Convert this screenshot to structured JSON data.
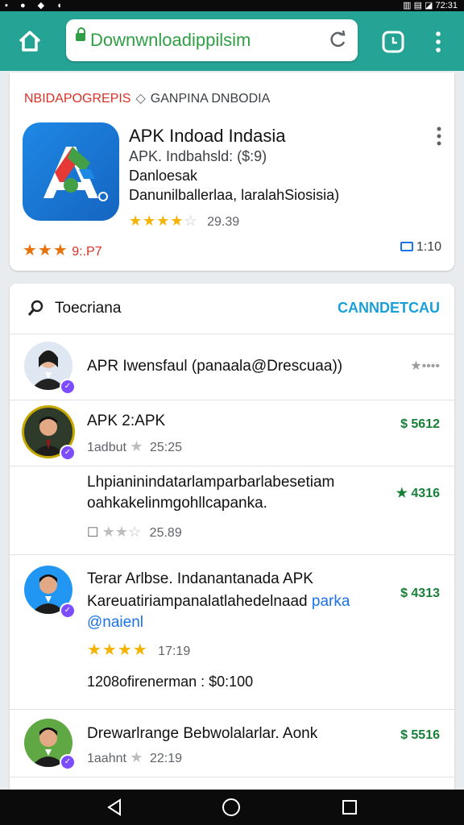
{
  "status_bar": {
    "left": "▪ ● ◆ ◖",
    "right": "▥ ▤ ◪ 72:31"
  },
  "toolbar": {
    "url": "Downwnloadippilsim"
  },
  "app": {
    "breadcrumb_primary": "NBIDAPOGREPIS",
    "breadcrumb_separator": "◇",
    "breadcrumb_secondary": "GANPINA DNBODIA",
    "title": "APK Indoad Indasia",
    "subtitle": "APK. Indbahsld: ($:9)",
    "developer": "Danloesak",
    "description": "Danunilballerlaa, laralahSiosisia)",
    "rating_stars": "★★★★",
    "rating_empty": "☆",
    "rating_count": "29.39",
    "secondary_stars": "★★★",
    "secondary_rating": "9:.P7",
    "files_value": "1:10"
  },
  "list": {
    "title": "Toecriana",
    "action": "CANNDETCAU",
    "items": [
      {
        "line1": "APR Iwensfaul (panaala@Drescuaa))",
        "right": "★••••"
      },
      {
        "line1": "APK 2:APK",
        "meta_label": "1adbut",
        "meta_time": "25:25",
        "right": "$ 5612"
      },
      {
        "line1": "Lhpianinindatarlamparbarlabesetiam",
        "line2": "oahkakelinmgohllcapanka.",
        "meta_prefix": "☐",
        "meta_stars": "★★☆",
        "meta_time": "25.89",
        "right": "★ 4316"
      },
      {
        "line1": "Terar Arlbse. Indanantanada APK",
        "line2": "Kareuatiriampanalatlahedelnaad",
        "line2_link": "parka",
        "line3": "@naienl",
        "stars": "★★★★",
        "time": "17:19",
        "footer": "1208ofirenerman : $0:100",
        "right": "$ 4313"
      },
      {
        "line1": "Drewarlrange Bebwolalarlar. Aonk",
        "meta_label": "1aahnt",
        "meta_time": "22:19",
        "right": "$ 5516"
      }
    ]
  },
  "colors": {
    "toolbar": "#25a395",
    "accent_link": "#1a9fd6",
    "price_green": "#188038",
    "breadcrumb_red": "#d93025",
    "star_gold": "#f5b301",
    "badge_purple": "#7c4dff"
  },
  "icons": [
    "home-icon",
    "lock-icon",
    "reload-icon",
    "clock-icon",
    "more-vert-icon",
    "search-icon",
    "folder-icon",
    "back-icon",
    "home-circle-icon",
    "recents-icon"
  ]
}
